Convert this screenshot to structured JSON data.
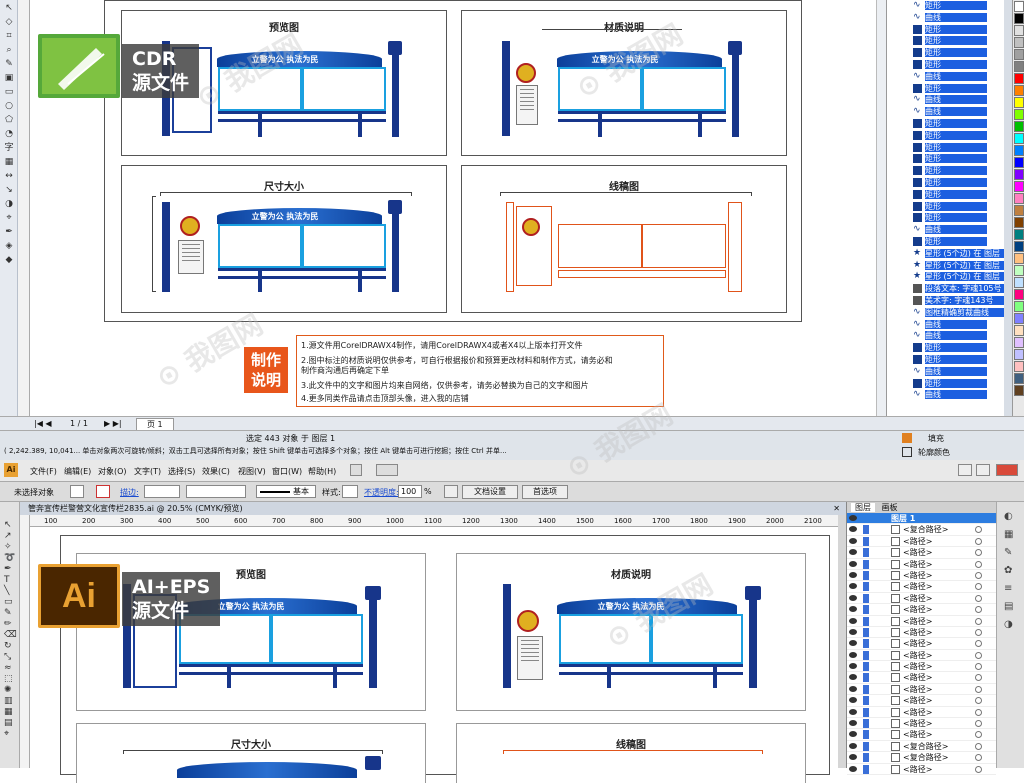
{
  "corel": {
    "badge_label_line1": "CDR",
    "badge_label_line2": "源文件",
    "panels": [
      {
        "title": "预览图",
        "slogan": "立警为公  执法为民"
      },
      {
        "title": "材质说明",
        "slogan": "立警为公  执法为民"
      },
      {
        "title": "尺寸大小",
        "slogan": "立警为公  执法为民"
      },
      {
        "title": "线稿图",
        "slogan": ""
      }
    ],
    "notes_title_line1": "制作",
    "notes_title_line2": "说明",
    "notes": [
      "1.源文件用CorelDRAWX4制作，请用CorelDRAWX4或者X4以上版本打开文件",
      "2.图中标注的材质说明仅供参考，可自行根据报价和预算更改材料和制作方式，请务必和",
      "制作商沟通后再确定下单",
      "3.此文件中的文字和图片均来自网络，仅供参考，请务必替换为自己的文字和图片",
      "4.更多同类作品请点击顶部头像，进入我的店铺"
    ],
    "page_nav": "1 / 1",
    "page_tab": "页 1",
    "status_selected": "选定 443 对象 于 图层 1",
    "status_coords": "( 2,242.389, 10,041... 单击对象两次可旋转/倾斜；双击工具可选择所有对象；按住 Shift 键单击可选择多个对象；按住 Alt 键单击可进行挖掘；按住 Ctrl 并单...",
    "fill_label": "填充",
    "outline_label": "轮廓颜色",
    "objects": [
      {
        "icon": "curve",
        "label": "矩形"
      },
      {
        "icon": "curve",
        "label": "曲线"
      },
      {
        "icon": "rect",
        "label": "矩形"
      },
      {
        "icon": "rect",
        "label": "矩形"
      },
      {
        "icon": "rect",
        "label": "矩形"
      },
      {
        "icon": "rect",
        "label": "矩形"
      },
      {
        "icon": "curve",
        "label": "曲线"
      },
      {
        "icon": "rect",
        "label": "矩形"
      },
      {
        "icon": "curve",
        "label": "曲线"
      },
      {
        "icon": "curve",
        "label": "曲线"
      },
      {
        "icon": "rect",
        "label": "矩形"
      },
      {
        "icon": "rect",
        "label": "矩形"
      },
      {
        "icon": "rect",
        "label": "矩形"
      },
      {
        "icon": "rect",
        "label": "矩形"
      },
      {
        "icon": "rect",
        "label": "矩形"
      },
      {
        "icon": "rect",
        "label": "矩形"
      },
      {
        "icon": "rect",
        "label": "矩形"
      },
      {
        "icon": "rect",
        "label": "矩形"
      },
      {
        "icon": "rect",
        "label": "矩形"
      },
      {
        "icon": "curve",
        "label": "曲线"
      },
      {
        "icon": "rect",
        "label": "矩形"
      },
      {
        "icon": "star",
        "label": "星形 (5个边) 在 图层"
      },
      {
        "icon": "star",
        "label": "星形 (5个边) 在 图层"
      },
      {
        "icon": "star",
        "label": "星形 (5个边) 在 图层"
      },
      {
        "icon": "text",
        "label": "段落文本: 字魂105号"
      },
      {
        "icon": "text",
        "label": "美术字: 字魂143号"
      },
      {
        "icon": "curve",
        "label": "图框精确剪裁曲线"
      },
      {
        "icon": "curve",
        "label": "曲线"
      },
      {
        "icon": "curve",
        "label": "曲线"
      },
      {
        "icon": "rect",
        "label": "矩形"
      },
      {
        "icon": "rect",
        "label": "矩形"
      },
      {
        "icon": "curve",
        "label": "曲线"
      },
      {
        "icon": "rect",
        "label": "矩形"
      },
      {
        "icon": "curve",
        "label": "曲线"
      }
    ],
    "palette": [
      "#ffffff",
      "#000000",
      "#e0e0e0",
      "#c0c0c0",
      "#a0a0a0",
      "#808080",
      "#ff0000",
      "#ff8000",
      "#ffff00",
      "#80ff00",
      "#00c000",
      "#00ffff",
      "#0080ff",
      "#0000ff",
      "#8000ff",
      "#ff00ff",
      "#ff80c0",
      "#c08040",
      "#804000",
      "#008080",
      "#004080",
      "#ffc080",
      "#c0ffc0",
      "#c0e0ff",
      "#ff0080",
      "#80ff80",
      "#8080ff",
      "#ffe0c0",
      "#e0c0ff",
      "#c0c0ff",
      "#ffc0c0",
      "#406080",
      "#604020"
    ]
  },
  "ai": {
    "badge_label_line1": "AI+EPS",
    "badge_label_line2": "源文件",
    "menus": [
      "文件(F)",
      "编辑(E)",
      "对象(O)",
      "文字(T)",
      "选择(S)",
      "效果(C)",
      "视图(V)",
      "窗口(W)",
      "帮助(H)"
    ],
    "ctrl_no_selection": "未选择对象",
    "ctrl_stroke_label": "描边:",
    "ctrl_basic": "基本",
    "ctrl_style": "样式:",
    "ctrl_opacity_label": "不透明度:",
    "ctrl_opacity_value": "100",
    "ctrl_opacity_unit": "%",
    "btn_doc_setup": "文档设置",
    "btn_prefs": "首选项",
    "doc_tab": "管奔宣传栏警营文化宣传栏2835.ai @ 20.5% (CMYK/预览)",
    "ruler_ticks": [
      "100",
      "200",
      "300",
      "400",
      "500",
      "600",
      "700",
      "800",
      "900",
      "1000",
      "1100",
      "1200",
      "1300",
      "1400",
      "1500",
      "1600",
      "1700",
      "1800",
      "1900",
      "2000",
      "2100"
    ],
    "layers_tab1": "图层",
    "layers_tab2": "画板",
    "layer_top": "图层 1",
    "layers": [
      "<复合路径>",
      "<路径>",
      "<路径>",
      "<路径>",
      "<路径>",
      "<路径>",
      "<路径>",
      "<路径>",
      "<路径>",
      "<路径>",
      "<路径>",
      "<路径>",
      "<路径>",
      "<路径>",
      "<路径>",
      "<路径>",
      "<路径>",
      "<路径>",
      "<路径>",
      "<复合路径>",
      "<复合路径>",
      "<路径>"
    ],
    "panels": [
      {
        "title": "预览图",
        "slogan": "立警为公  执法为民"
      },
      {
        "title": "材质说明",
        "slogan": "立警为公  执法为民"
      },
      {
        "title": "尺寸大小",
        "slogan": ""
      },
      {
        "title": "线稿图",
        "slogan": ""
      }
    ]
  }
}
